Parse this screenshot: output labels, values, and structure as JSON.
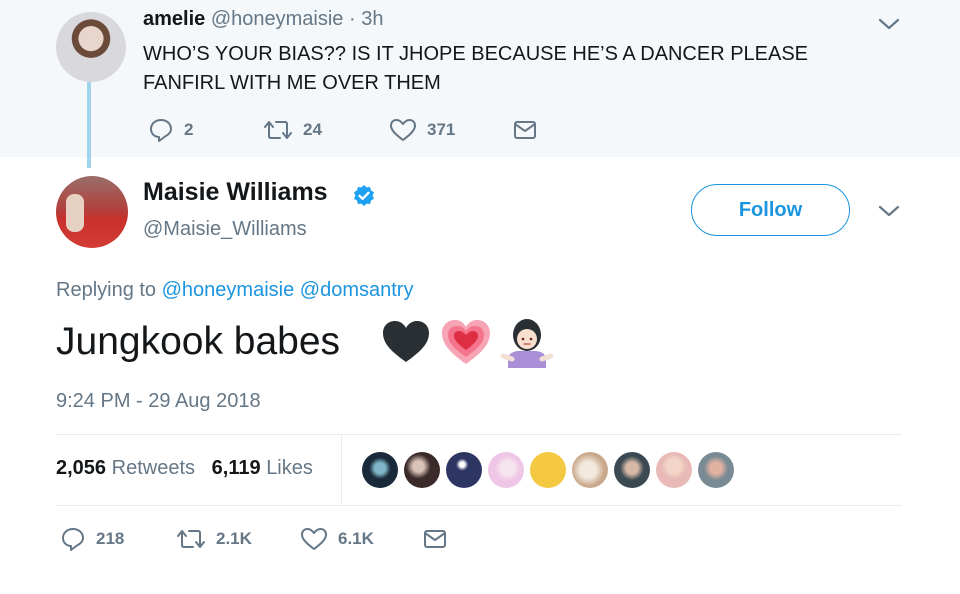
{
  "parent_tweet": {
    "name": "amelie",
    "handle": "@honeymaisie",
    "separator": "·",
    "time": "3h",
    "text": "WHO’S YOUR BIAS?? IS IT JHOPE BECAUSE HE’S A DANCER PLEASE FANFIRL WITH ME OVER THEM",
    "replies": "2",
    "retweets": "24",
    "likes": "371"
  },
  "main_tweet": {
    "name": "Maisie Williams",
    "handle": "@Maisie_Williams",
    "follow_label": "Follow",
    "replying_prefix": "Replying to",
    "reply_to": [
      "@honeymaisie",
      "@domsantry"
    ],
    "text": "Jungkook babes",
    "emoji": [
      "black-heart",
      "growing-heart",
      "woman-shrugging"
    ],
    "timestamp": "9:24 PM - 29 Aug 2018",
    "retweet_count": "2,056",
    "retweet_label": "Retweets",
    "like_count": "6,119",
    "like_label": "Likes",
    "replies": "218",
    "retweets_short": "2.1K",
    "likes_short": "6.1K"
  },
  "liker_avatar_colors": [
    "#1a2a3a",
    "#3a2a2a",
    "#2d3563",
    "#f0c6e6",
    "#f5c842",
    "#e2d3c5",
    "#3b4a52",
    "#e8b9b6",
    "#7a8a94"
  ],
  "colors": {
    "accent": "#1b95e0",
    "muted": "#657786",
    "thread_line": "#9fd3ee",
    "parent_bg": "#f5f8fa"
  }
}
